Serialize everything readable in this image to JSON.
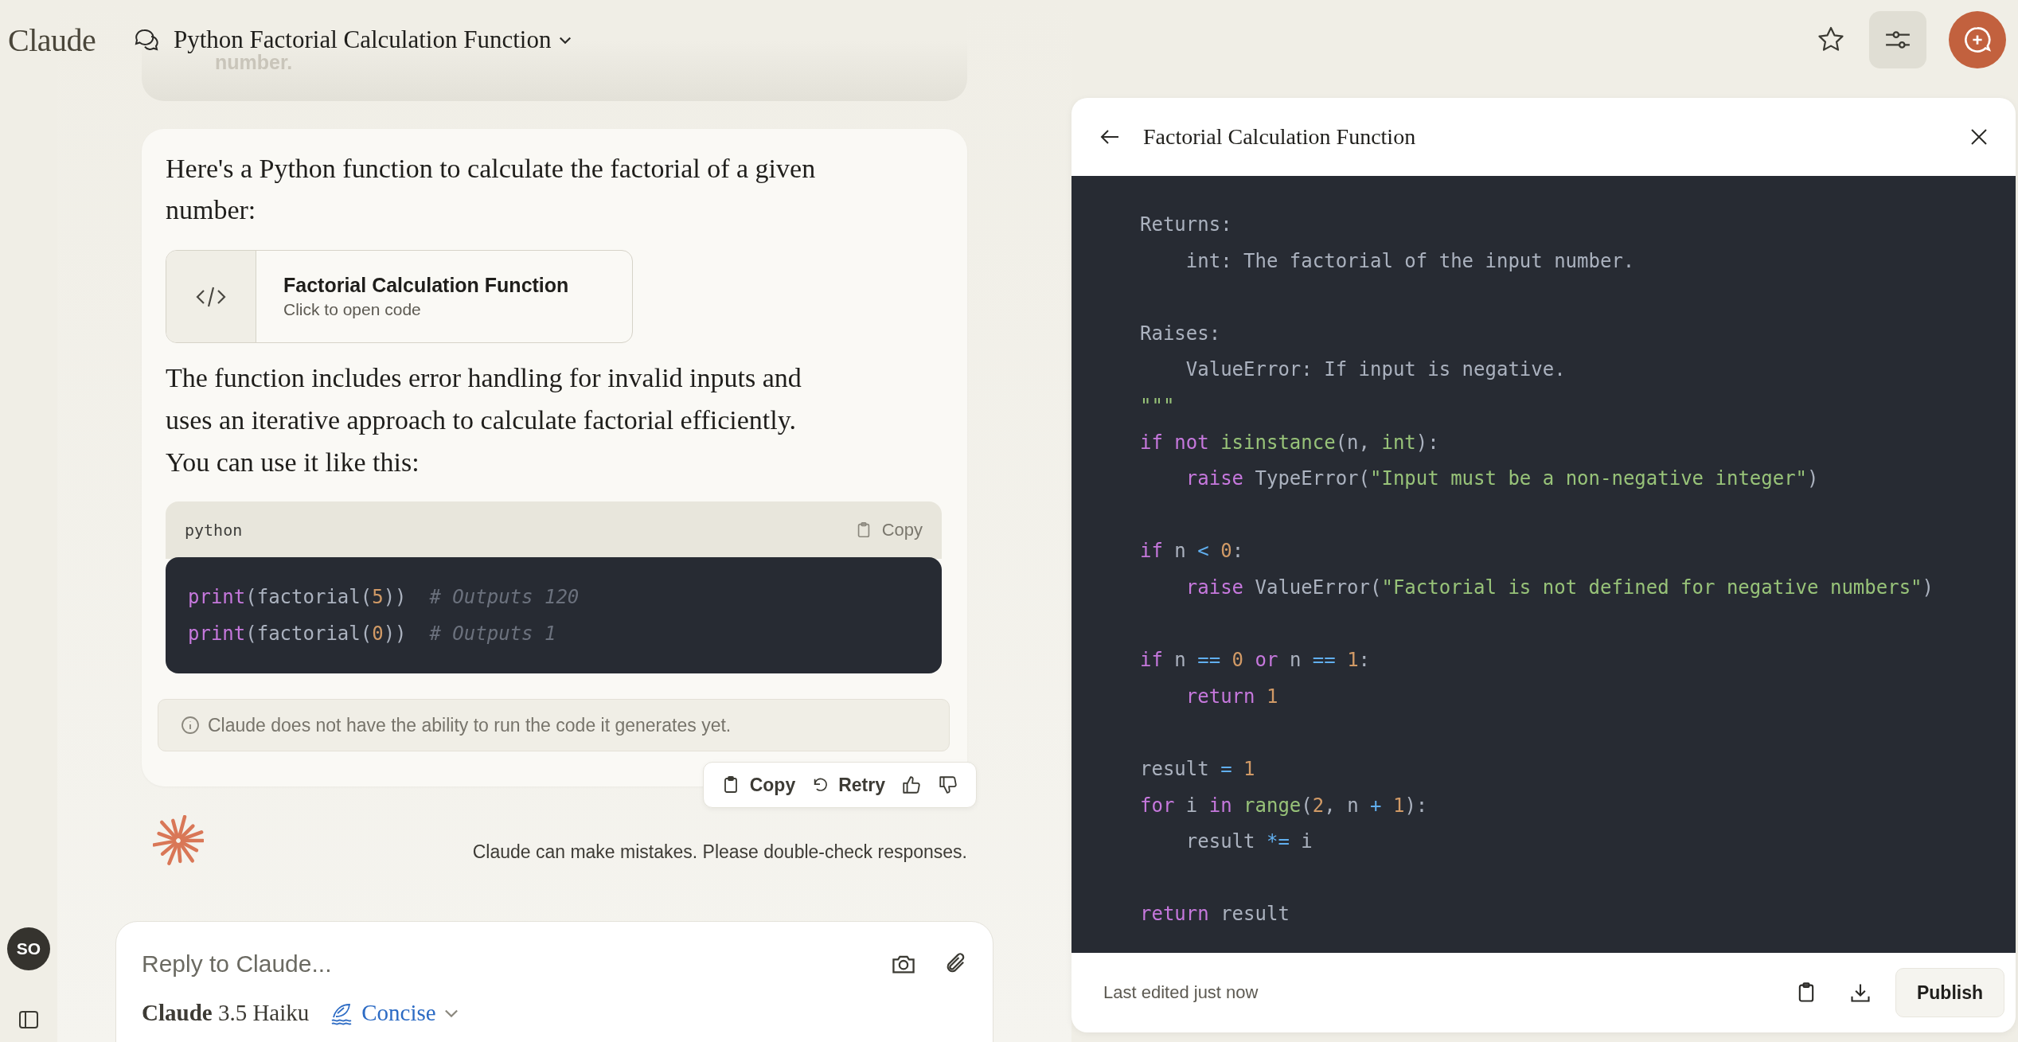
{
  "header": {
    "logo": "Claude",
    "title": "Python Factorial Calculation Function",
    "settings_active": true
  },
  "previous_message": {
    "text": "number."
  },
  "response": {
    "intro": "Here's a Python function to calculate the factorial of a given number:",
    "artifact": {
      "title": "Factorial Calculation Function",
      "subtitle": "Click to open code"
    },
    "explanation": "The function includes error handling for invalid inputs and uses an iterative approach to calculate factorial efficiently. You can use it like this:",
    "code_block": {
      "language": "python",
      "copy_label": "Copy",
      "lines": [
        {
          "kind": "code",
          "tokens": [
            {
              "text": "print",
              "kind": "keyword"
            },
            {
              "text": "(factorial(",
              "kind": "plain"
            },
            {
              "text": "5",
              "kind": "number"
            },
            {
              "text": "))  ",
              "kind": "plain"
            },
            {
              "text": "# Outputs 120",
              "kind": "comment"
            }
          ]
        },
        {
          "kind": "code",
          "tokens": [
            {
              "text": "print",
              "kind": "keyword"
            },
            {
              "text": "(factorial(",
              "kind": "plain"
            },
            {
              "text": "0",
              "kind": "number"
            },
            {
              "text": "))  ",
              "kind": "plain"
            },
            {
              "text": "# Outputs 1",
              "kind": "comment"
            }
          ]
        }
      ]
    },
    "note": "Claude does not have the ability to run the code it generates yet.",
    "actions": {
      "copy": "Copy",
      "retry": "Retry"
    }
  },
  "disclaimer": "Claude can make mistakes. Please double-check responses.",
  "composer": {
    "placeholder": "Reply to Claude...",
    "model": "**Claude** 3.5 Haiku",
    "style": "Concise"
  },
  "user": {
    "initials": "SO"
  },
  "artifact_panel": {
    "title": "Factorial Calculation Function",
    "status": "Last edited just now",
    "publish": "Publish",
    "lines": [
      {
        "kind": "code",
        "tokens": [
          {
            "text": "Returns:",
            "kind": "plain"
          }
        ]
      },
      {
        "kind": "code",
        "tokens": [
          {
            "text": "    int: The factorial of the input number.",
            "kind": "plain"
          }
        ]
      },
      {
        "kind": "blank"
      },
      {
        "kind": "code",
        "tokens": [
          {
            "text": "Raises:",
            "kind": "plain"
          }
        ]
      },
      {
        "kind": "code",
        "tokens": [
          {
            "text": "    ValueError: If input is negative.",
            "kind": "plain"
          }
        ]
      },
      {
        "kind": "code",
        "tokens": [
          {
            "text": "\"\"\"",
            "kind": "string"
          }
        ]
      },
      {
        "kind": "code",
        "tokens": [
          {
            "text": "if",
            "kind": "keyword"
          },
          {
            "text": " not",
            "kind": "keyword"
          },
          {
            "text": " isinstance",
            "kind": "builtin"
          },
          {
            "text": "(n, ",
            "kind": "plain"
          },
          {
            "text": "int",
            "kind": "builtin"
          },
          {
            "text": "):",
            "kind": "plain"
          }
        ]
      },
      {
        "kind": "code",
        "tokens": [
          {
            "text": "    raise",
            "kind": "keyword"
          },
          {
            "text": " TypeError(",
            "kind": "plain"
          },
          {
            "text": "\"Input must be a non-negative integer\"",
            "kind": "string"
          },
          {
            "text": ")",
            "kind": "plain"
          }
        ]
      },
      {
        "kind": "blank"
      },
      {
        "kind": "code",
        "tokens": [
          {
            "text": "if",
            "kind": "keyword"
          },
          {
            "text": " n ",
            "kind": "plain"
          },
          {
            "text": "<",
            "kind": "operator"
          },
          {
            "text": " 0",
            "kind": "number"
          },
          {
            "text": ":",
            "kind": "plain"
          }
        ]
      },
      {
        "kind": "code",
        "tokens": [
          {
            "text": "    raise",
            "kind": "keyword"
          },
          {
            "text": " ValueError(",
            "kind": "plain"
          },
          {
            "text": "\"Factorial is not defined for negative numbers\"",
            "kind": "string"
          },
          {
            "text": ")",
            "kind": "plain"
          }
        ]
      },
      {
        "kind": "blank"
      },
      {
        "kind": "code",
        "tokens": [
          {
            "text": "if",
            "kind": "keyword"
          },
          {
            "text": " n ",
            "kind": "plain"
          },
          {
            "text": "==",
            "kind": "operator"
          },
          {
            "text": " 0",
            "kind": "number"
          },
          {
            "text": " or",
            "kind": "keyword"
          },
          {
            "text": " n ",
            "kind": "plain"
          },
          {
            "text": "==",
            "kind": "operator"
          },
          {
            "text": " 1",
            "kind": "number"
          },
          {
            "text": ":",
            "kind": "plain"
          }
        ]
      },
      {
        "kind": "code",
        "tokens": [
          {
            "text": "    return",
            "kind": "keyword"
          },
          {
            "text": " 1",
            "kind": "number"
          }
        ]
      },
      {
        "kind": "blank"
      },
      {
        "kind": "code",
        "tokens": [
          {
            "text": "result ",
            "kind": "plain"
          },
          {
            "text": "=",
            "kind": "operator"
          },
          {
            "text": " 1",
            "kind": "number"
          }
        ]
      },
      {
        "kind": "code",
        "tokens": [
          {
            "text": "for",
            "kind": "keyword"
          },
          {
            "text": " i ",
            "kind": "plain"
          },
          {
            "text": "in",
            "kind": "keyword"
          },
          {
            "text": " range",
            "kind": "builtin"
          },
          {
            "text": "(",
            "kind": "plain"
          },
          {
            "text": "2",
            "kind": "number"
          },
          {
            "text": ", n ",
            "kind": "plain"
          },
          {
            "text": "+",
            "kind": "operator"
          },
          {
            "text": " 1",
            "kind": "number"
          },
          {
            "text": "):",
            "kind": "plain"
          }
        ]
      },
      {
        "kind": "code",
        "tokens": [
          {
            "text": "    result ",
            "kind": "plain"
          },
          {
            "text": "*=",
            "kind": "operator"
          },
          {
            "text": " i",
            "kind": "plain"
          }
        ]
      },
      {
        "kind": "blank"
      },
      {
        "kind": "code",
        "tokens": [
          {
            "text": "return",
            "kind": "keyword"
          },
          {
            "text": " result",
            "kind": "plain"
          }
        ]
      }
    ]
  }
}
